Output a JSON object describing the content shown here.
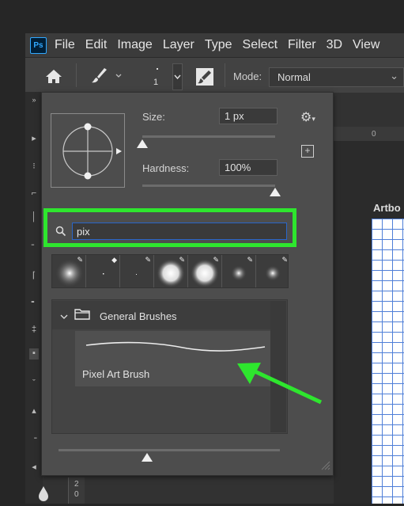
{
  "app": {
    "logo": "Ps"
  },
  "menu": [
    "File",
    "Edit",
    "Image",
    "Layer",
    "Type",
    "Select",
    "Filter",
    "3D",
    "View"
  ],
  "options_bar": {
    "size_value": "1",
    "mode_label": "Mode:",
    "mode_value": "Normal"
  },
  "brush_picker": {
    "size_label": "Size:",
    "size_value": "1 px",
    "hardness_label": "Hardness:",
    "hardness_value": "100%",
    "size_level": 0.0,
    "hardness_level": 1.0,
    "search_value": "pix",
    "group_label": "General Brushes",
    "brush_name": "Pixel Art Brush",
    "bottom_slider_level": 0.4
  },
  "canvas": {
    "artboard_label": "Artbo",
    "ruler_zero": "0",
    "toolbar_digits": [
      "2",
      "0"
    ]
  },
  "annotation": {
    "highlight_color": "#2ee62e",
    "arrow_color": "#2ee62e"
  },
  "colors": {
    "accent_blue": "#2a66c9",
    "grid": "#4f7fd8"
  }
}
